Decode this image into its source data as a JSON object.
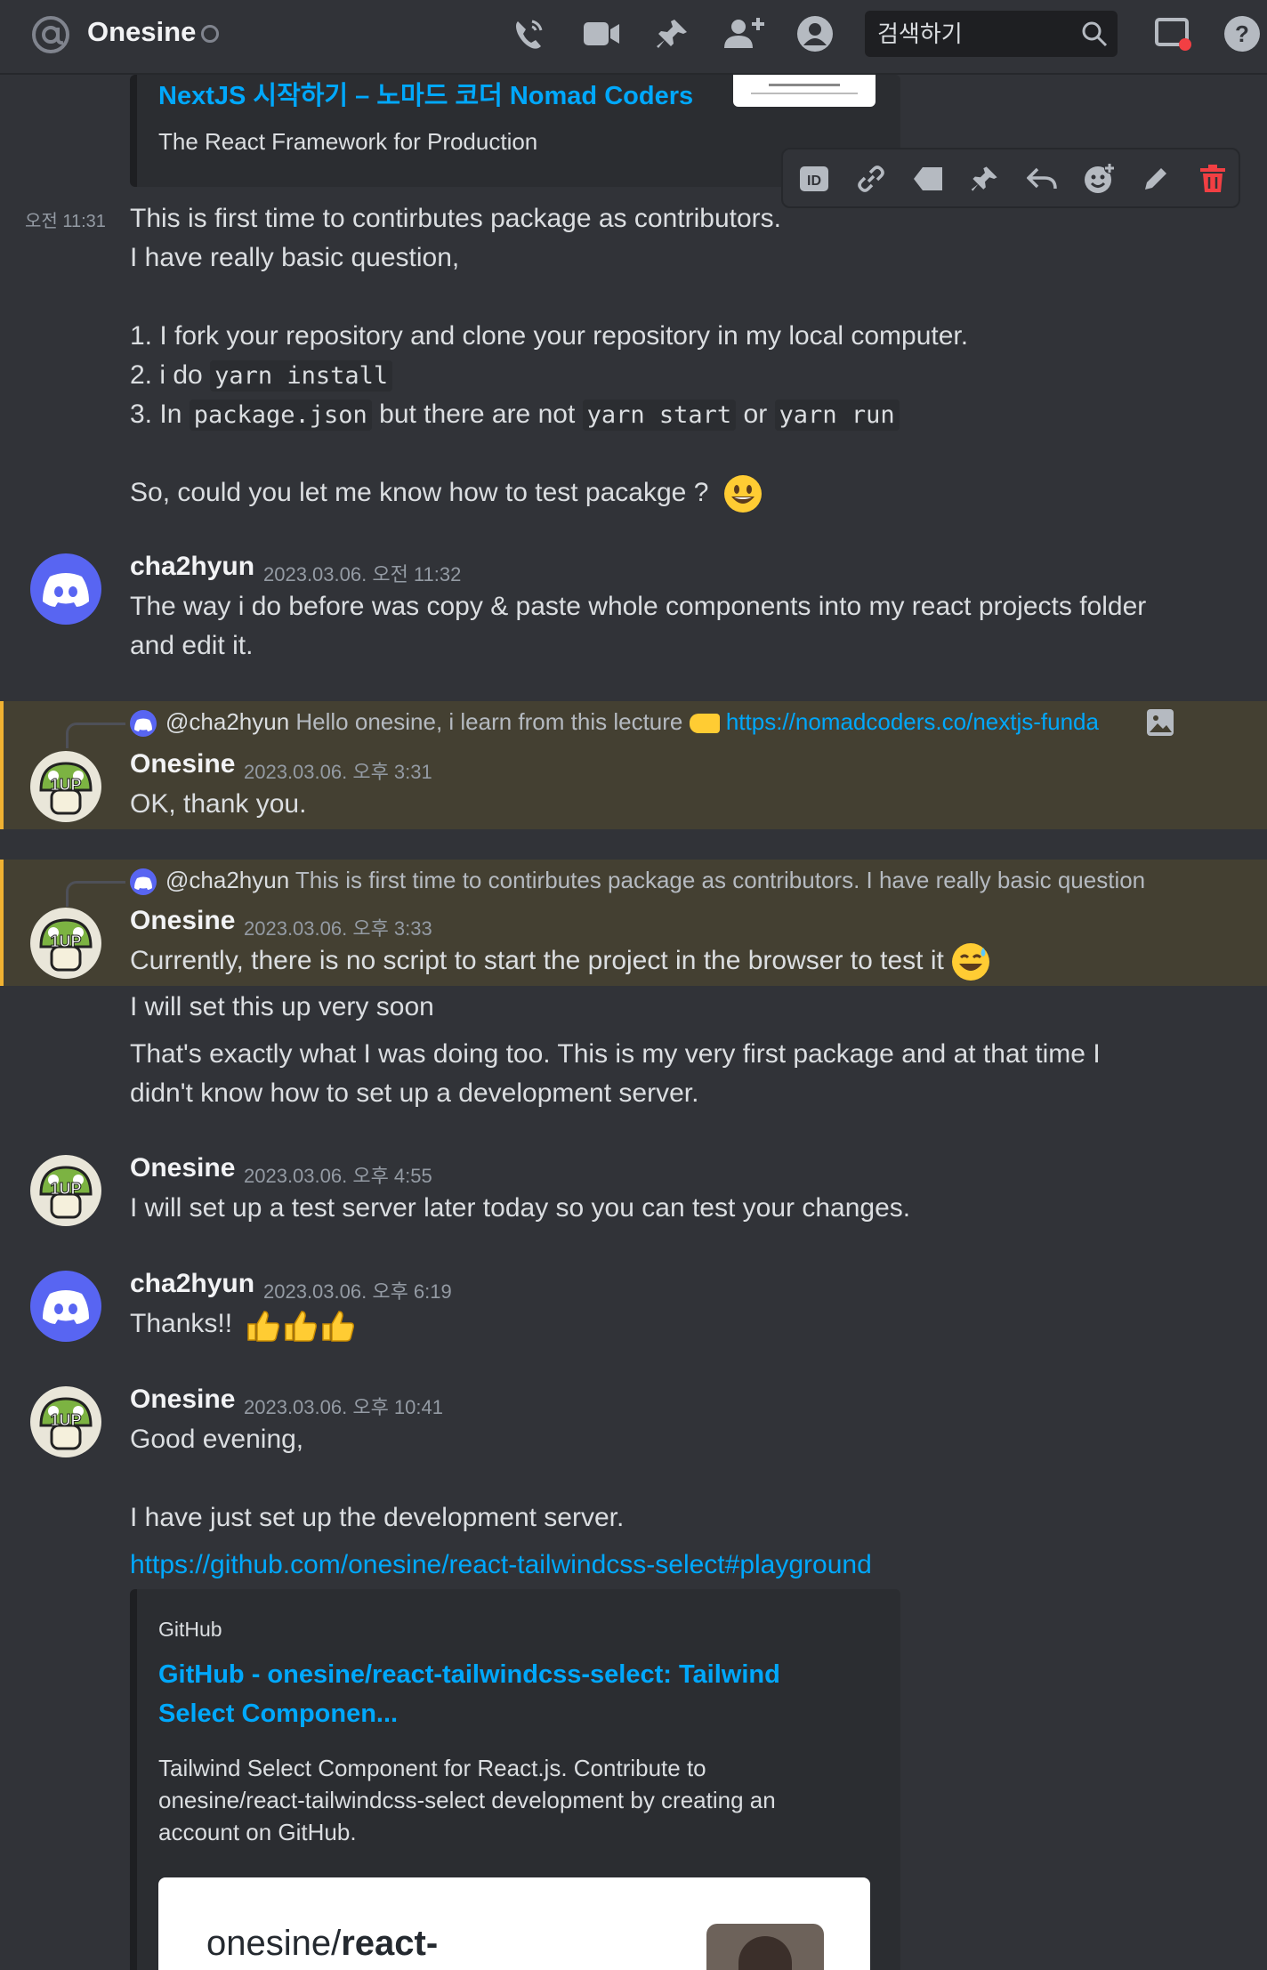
{
  "header": {
    "title": "Onesine",
    "search_placeholder": "검색하기"
  },
  "top_embed": {
    "title": "NextJS 시작하기 – 노마드 코더 Nomad Coders",
    "description": "The React Framework for Production"
  },
  "messages": [
    {
      "time": "오전 11:31",
      "lines": {
        "l1": "This is first time to contirbutes package as contributors.",
        "l2": "I have really basic question,",
        "l3": "1. I fork your repository and clone your repository in my local computer.",
        "l4_prefix": "2. i do ",
        "l4_code": "yarn install",
        "l5_prefix": "3. In ",
        "l5_code1": "package.json",
        "l5_mid": " but there are not ",
        "l5_code2": "yarn start",
        "l5_or": " or ",
        "l5_code3": "yarn run",
        "l6": "So, could you let me know how to test pacakge ?"
      }
    },
    {
      "author": "cha2hyun",
      "date": "2023.03.06. 오전 11:32",
      "text1": "The way i do before was copy & paste whole components into my react projects folder",
      "text2": "and edit it."
    },
    {
      "reply_author": "@cha2hyun",
      "reply_text": "Hello onesine, i learn from this lecture",
      "reply_link": "https://nomadcoders.co/nextjs-funda",
      "author": "Onesine",
      "date": "2023.03.06. 오후 3:31",
      "text": "OK, thank you."
    },
    {
      "reply_author": "@cha2hyun",
      "reply_text": "This is first time to contirbutes package as contributors. I have really basic question",
      "author": "Onesine",
      "date": "2023.03.06. 오후 3:33",
      "text": "Currently, there is no script to start the project in the browser to test it",
      "follow1": "I will set this up very soon",
      "follow2": "That's exactly what I was doing too. This is my very first package and at that time I",
      "follow3": "didn't know how to set up a development server."
    },
    {
      "author": "Onesine",
      "date": "2023.03.06. 오후 4:55",
      "text": "I will set up a test server later today so you can test your changes."
    },
    {
      "author": "cha2hyun",
      "date": "2023.03.06. 오후 6:19",
      "text": "Thanks!!"
    },
    {
      "author": "Onesine",
      "date": "2023.03.06. 오후 10:41",
      "text1": "Good evening,",
      "text2": "I have just set up the development server.",
      "link": "https://github.com/onesine/react-tailwindcss-select#playground"
    }
  ],
  "github_embed": {
    "provider": "GitHub",
    "title1": "GitHub - onesine/react-tailwindcss-select: Tailwind",
    "title2": "Select Componen...",
    "desc1": "Tailwind Select Component for React.js. Contribute to",
    "desc2": "onesine/react-tailwindcss-select development by creating an",
    "desc3": "account on GitHub.",
    "card_owner": "onesine/",
    "card_repo": "react-"
  },
  "colors": {
    "background": "#313338",
    "link": "#00a8fc",
    "highlight": "#444032",
    "highlight_bar": "#f0b232",
    "blurple": "#5865f2",
    "danger": "#f23f43"
  }
}
